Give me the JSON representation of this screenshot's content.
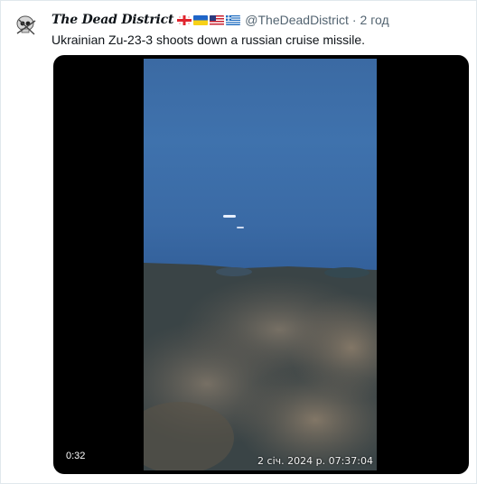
{
  "tweet": {
    "author_name": "The Dead District",
    "flags": [
      "georgia-flag",
      "ukraine-flag",
      "usa-flag",
      "greece-flag"
    ],
    "handle": "@TheDeadDistrict",
    "separator": "·",
    "time": "2 год",
    "text": "Ukrainian Zu-23-3 shoots down a russian cruise missile."
  },
  "media": {
    "video_timestamp": "2 січ. 2024 р. 07:37:04",
    "duration": "0:32"
  },
  "colors": {
    "text_primary": "#0f1419",
    "text_secondary": "#536471",
    "media_background": "#000000"
  }
}
